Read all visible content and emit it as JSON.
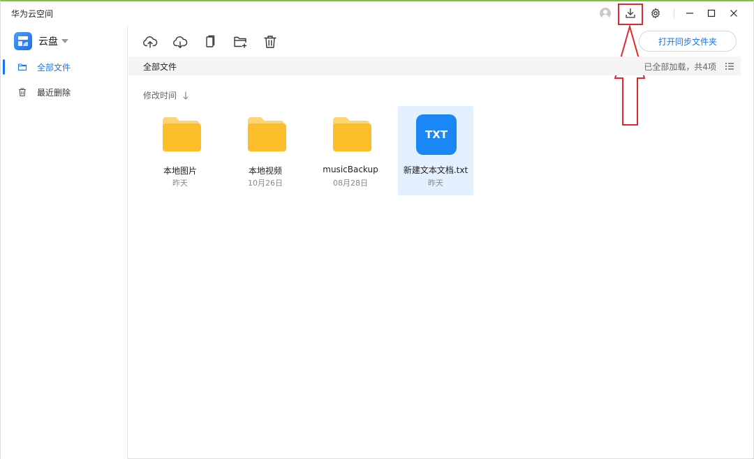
{
  "window": {
    "title": "华为云空间"
  },
  "sidebar": {
    "brand_label": "云盘",
    "items": [
      {
        "label": "全部文件",
        "active": true
      },
      {
        "label": "最近删除",
        "active": false
      }
    ]
  },
  "toolbar": {
    "icons": [
      "upload-cloud-icon",
      "download-cloud-icon",
      "copy-icon",
      "new-folder-icon",
      "delete-icon"
    ],
    "sync_button_label": "打开同步文件夹"
  },
  "pathbar": {
    "breadcrumb": "全部文件",
    "status": "已全部加载，共4项"
  },
  "sort": {
    "label": "修改时间"
  },
  "files": [
    {
      "name": "本地图片",
      "date": "昨天",
      "type": "folder"
    },
    {
      "name": "本地视频",
      "date": "10月26日",
      "type": "folder"
    },
    {
      "name": "musicBackup",
      "date": "08月28日",
      "type": "folder"
    },
    {
      "name": "新建文本文档.txt",
      "date": "昨天",
      "type": "txt",
      "badge": "TXT",
      "selected": true
    }
  ],
  "colors": {
    "accent": "#1a73e8",
    "folder": "#fbbd29",
    "txt_badge": "#1a87f7",
    "annotation": "#e0282c"
  }
}
